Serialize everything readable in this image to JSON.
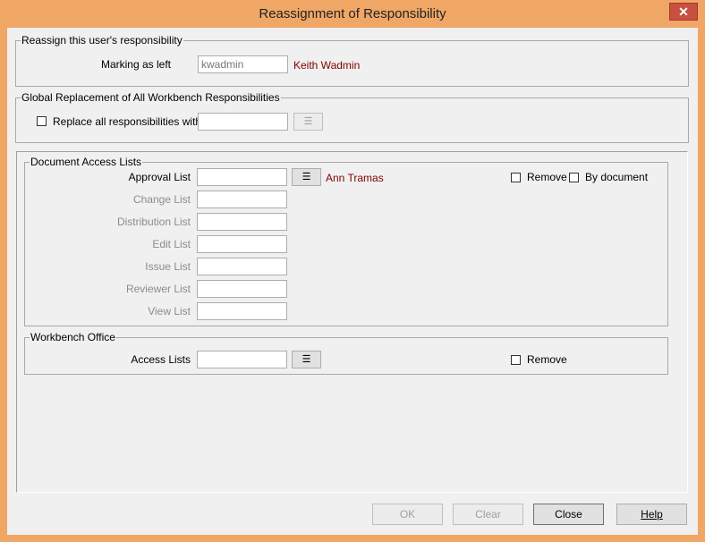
{
  "window": {
    "title": "Reassignment of Responsibility",
    "close_glyph": "✕"
  },
  "reassign": {
    "legend": "Reassign this user's responsibility",
    "marking_label": "Marking as left",
    "marking_value": "kwadmin",
    "marking_name": "Keith Wadmin"
  },
  "global": {
    "legend": "Global Replacement of All Workbench Responsibilities",
    "replace_label": "Replace all responsibilities with",
    "replace_value": ""
  },
  "doclists": {
    "legend": "Document Access Lists",
    "approval_label": "Approval List",
    "approval_name": "Ann Tramas",
    "change_label": "Change List",
    "distribution_label": "Distribution List",
    "edit_label": "Edit List",
    "issue_label": "Issue List",
    "reviewer_label": "Reviewer List",
    "view_label": "View List",
    "remove_label": "Remove",
    "bydoc_label": "By document"
  },
  "office": {
    "legend": "Workbench Office",
    "access_label": "Access Lists",
    "remove_label": "Remove"
  },
  "buttons": {
    "ok": "OK",
    "clear": "Clear",
    "close": "Close",
    "help": "Help"
  },
  "icons": {
    "lookup": "list-lookup-icon"
  }
}
